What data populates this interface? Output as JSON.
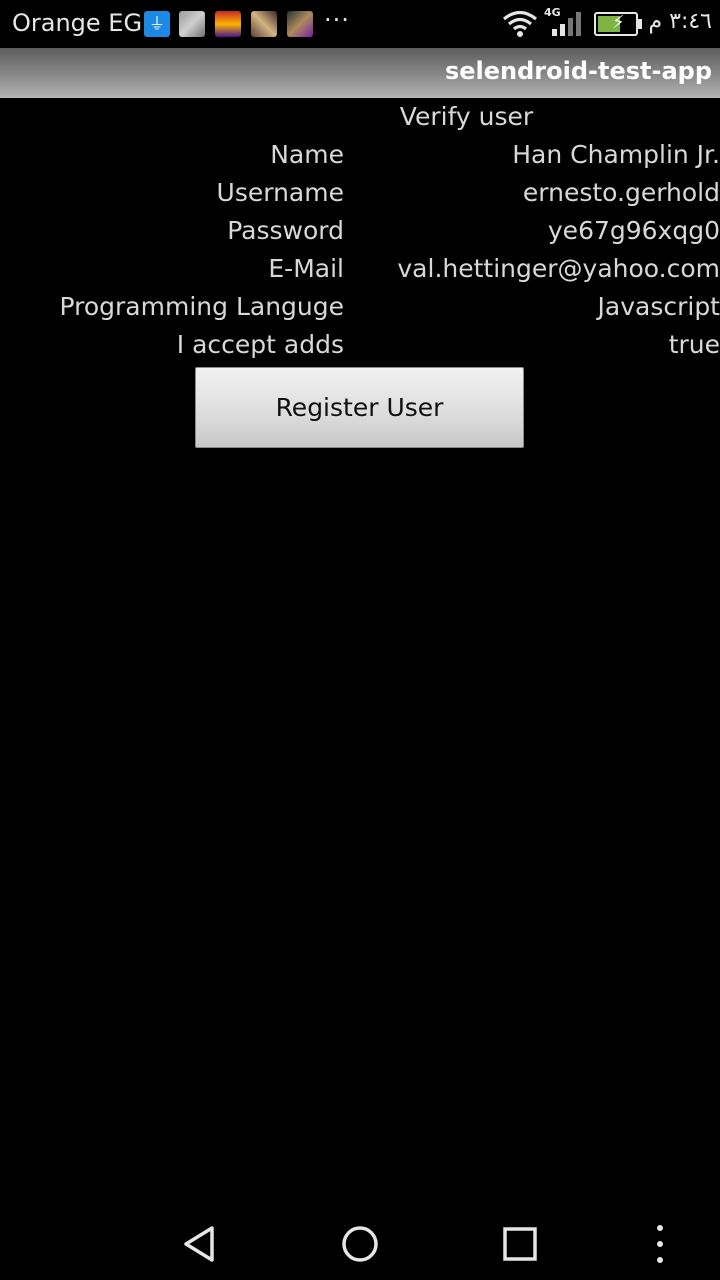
{
  "status_bar": {
    "carrier": "Orange EG",
    "more_label": "···",
    "network_type": "4G",
    "clock": "٣:٤٦ م",
    "icons": [
      "usb-icon",
      "notification-image-icon",
      "notification-image-icon",
      "notification-image-icon",
      "notification-image-icon",
      "wifi-icon",
      "signal-icon",
      "battery-charging-icon"
    ]
  },
  "action_bar": {
    "title": "selendroid-test-app"
  },
  "form": {
    "title": "Verify user",
    "fields": [
      {
        "label": "Name",
        "value": "Han Champlin Jr."
      },
      {
        "label": "Username",
        "value": "ernesto.gerhold"
      },
      {
        "label": "Password",
        "value": "ye67g96xqg0"
      },
      {
        "label": "E-Mail",
        "value": "val.hettinger@yahoo.com"
      },
      {
        "label": "Programming Languge",
        "value": "Javascript"
      },
      {
        "label": "I accept adds",
        "value": "true"
      }
    ],
    "register_label": "Register User"
  },
  "nav_bar": {
    "icons": [
      "back-icon",
      "home-icon",
      "recents-icon",
      "menu-icon"
    ]
  },
  "colors": {
    "background": "#000000",
    "text": "#d8d8d8",
    "action_bar_light": "#b5b5b5",
    "button_face": "#e0e0e0"
  }
}
